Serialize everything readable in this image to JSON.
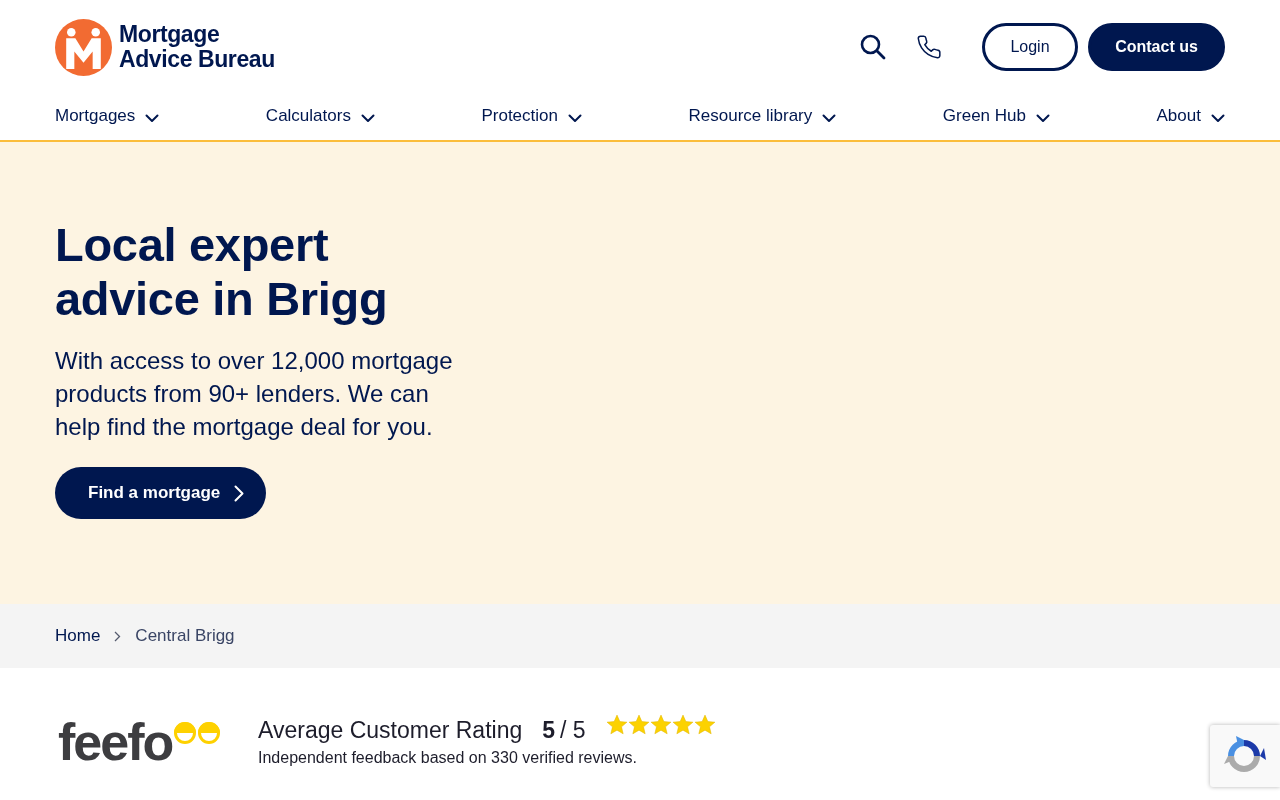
{
  "header": {
    "logo": {
      "line_1": "Mortgage",
      "line_2": "Advice Bureau"
    },
    "buttons": [
      {
        "label": "Login",
        "kind": "outline"
      },
      {
        "label": "Contact us",
        "kind": "filled"
      }
    ]
  },
  "nav": [
    {
      "label": "Mortgages"
    },
    {
      "label": "Calculators"
    },
    {
      "label": "Protection"
    },
    {
      "label": "Resource library"
    },
    {
      "label": "Green Hub"
    },
    {
      "label": "About"
    }
  ],
  "hero": {
    "heading": "Local expert advice in Brigg",
    "text": "With access to over 12,000 mortgage products from 90+ lenders. We can help find the mortgage deal for you.",
    "button": {
      "label": "Find a mortgage"
    }
  },
  "breadcrumb": [
    {
      "label": "Home",
      "current": false
    },
    {
      "label": "Central Brigg",
      "current": true
    }
  ],
  "rating": {
    "provider": "feefo",
    "title": "Average Customer Rating",
    "score": "5",
    "out_of": "/ 5",
    "stars": 5,
    "note": "Independent feedback based on 330 verified reviews."
  }
}
